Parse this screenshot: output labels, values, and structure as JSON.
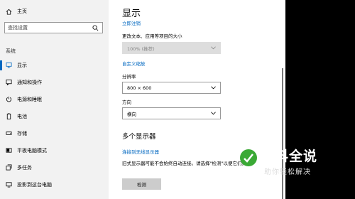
{
  "sidebar": {
    "home_label": "主页",
    "search_placeholder": "查找设置",
    "section_label": "系统",
    "items": [
      {
        "label": "显示",
        "icon": "monitor-icon",
        "active": true
      },
      {
        "label": "通知和操作",
        "icon": "notification-icon"
      },
      {
        "label": "电源和睡眠",
        "icon": "power-icon"
      },
      {
        "label": "电池",
        "icon": "battery-icon"
      },
      {
        "label": "存储",
        "icon": "storage-icon"
      },
      {
        "label": "平板电脑模式",
        "icon": "tablet-icon"
      },
      {
        "label": "多任务",
        "icon": "multitask-icon"
      },
      {
        "label": "投影到这台电脑",
        "icon": "projection-icon"
      }
    ]
  },
  "main": {
    "title": "显示",
    "apply_link": "立即注销",
    "scale_label": "更改文本、应用等项目的大小",
    "scale_value": "100% (推荐)",
    "custom_scale_link": "自定义缩放",
    "resolution_label": "分辨率",
    "resolution_value": "800 × 600",
    "orientation_label": "方向",
    "orientation_value": "横向",
    "multi_display_title": "多个显示器",
    "wireless_link": "连接到无线显示器",
    "detect_description": "旧式显示器可能不会始终自动连接。请选择\"检测\"以便它们。",
    "detect_button": "检测"
  },
  "watermark": {
    "title": "百科全说",
    "subtitle": "助你轻松解决"
  },
  "colors": {
    "accent": "#0067c0",
    "sidebar_bg": "#f2f2f2",
    "watermark_green": "#3aa935"
  }
}
